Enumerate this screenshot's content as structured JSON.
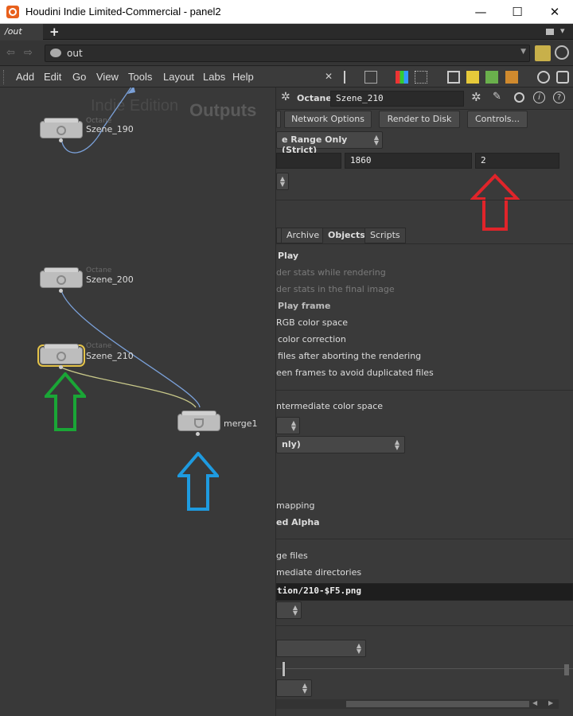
{
  "window": {
    "title": "Houdini Indie Limited-Commercial - panel2"
  },
  "tabs": {
    "active": "/out",
    "add_label": "+"
  },
  "path": {
    "value": "out"
  },
  "menu": {
    "items": [
      "Add",
      "Edit",
      "Go",
      "View",
      "Tools",
      "Layout",
      "Labs",
      "Help"
    ]
  },
  "network": {
    "watermark_edition": "Indie Edition",
    "watermark_context": "Outputs",
    "nodes": [
      {
        "type": "Octane",
        "name": "Szene_190"
      },
      {
        "type": "Octane",
        "name": "Szene_200"
      },
      {
        "type": "Octane",
        "name": "Szene_210"
      },
      {
        "type": "",
        "name": "merge1"
      }
    ]
  },
  "params": {
    "node_type": "Octane",
    "node_name": "Szene_210",
    "buttons": {
      "network_options": "Network Options",
      "render_to_disk": "Render to Disk",
      "controls": "Controls..."
    },
    "valid_frame_range": "e Range Only (Strict)",
    "frame_start": "",
    "frame_end": "1860",
    "frame_inc": "2",
    "tabs": [
      "Archive",
      "Objects",
      "Scripts"
    ],
    "active_tab": "Objects",
    "rows": [
      "Play",
      "der stats while rendering",
      "der stats in the final image",
      "Play frame",
      "RGB color space",
      "color correction",
      "files after aborting the rendering",
      "een frames to avoid duplicated files",
      "ntermediate color space",
      "nly)",
      "mapping",
      "ed Alpha",
      "ge files",
      "mediate directories"
    ],
    "output_path": "tion/210-$F5.png"
  },
  "annotations": {
    "colors": {
      "red": "#e0242a",
      "green": "#1aa636",
      "blue": "#1e9be0"
    }
  },
  "colors": {
    "accent": "#e5c44a",
    "wire_blue": "#7aa0d8",
    "wire_yellow": "#c9c98a"
  }
}
